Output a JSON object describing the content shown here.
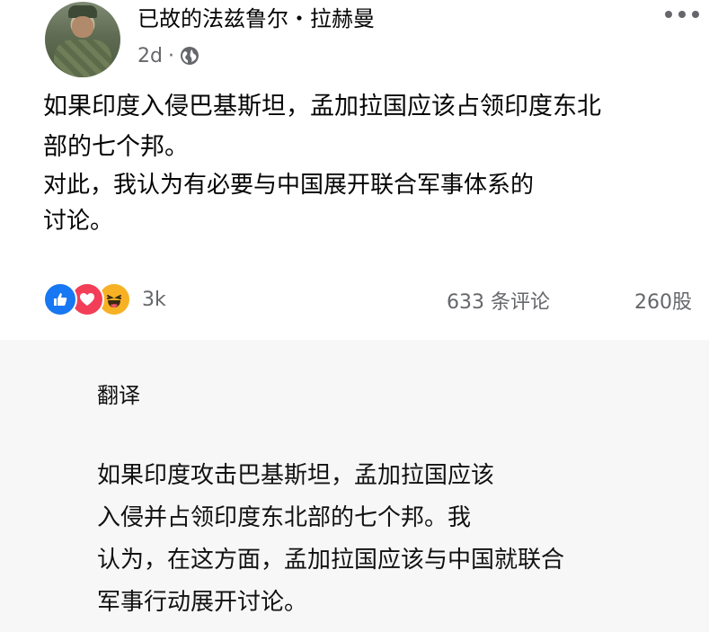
{
  "post": {
    "author": "已故的法兹鲁尔・拉赫曼",
    "time": "2d",
    "separator": "·",
    "privacy_icon": "globe-icon",
    "more_icon": "more-options-icon",
    "text_lines": [
      "如果印度入侵巴基斯坦，孟加拉国应该占领印度东北",
      "部的七个邦。",
      "对此，我认为有必要与中国展开联合军事体系的",
      "讨论。"
    ],
    "reactions": {
      "icons": [
        "like-icon",
        "love-icon",
        "haha-icon"
      ],
      "count": "3k"
    },
    "comments": "633 条评论",
    "shares": "260股"
  },
  "translation": {
    "title": "翻译",
    "lines": [
      "如果印度攻击巴基斯坦，孟加拉国应该",
      "入侵并占领印度东北部的七个邦。我",
      "认为，在这方面，孟加拉国应该与中国就联合",
      "军事行动展开讨论。"
    ]
  },
  "colors": {
    "like": "#1877f2",
    "love": "#f33e58",
    "haha": "#f7b125",
    "secondary_text": "#65676b"
  }
}
